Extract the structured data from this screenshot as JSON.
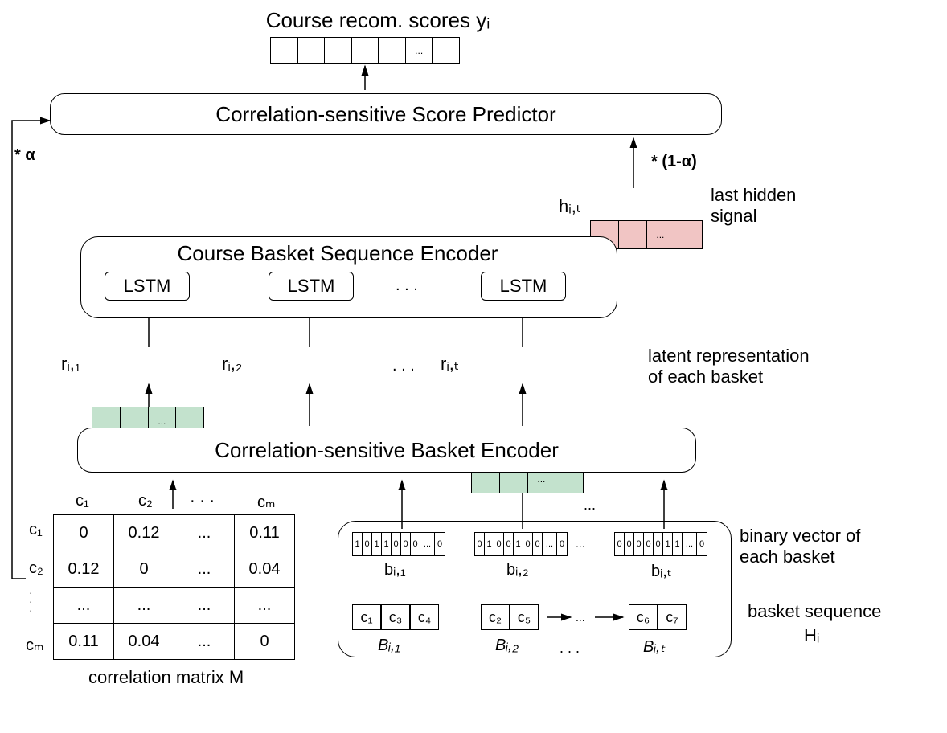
{
  "title_top": "Course recom. scores yᵢ",
  "predictor": "Correlation-sensitive Score Predictor",
  "alpha": "* α",
  "one_minus_alpha": "* (1-α)",
  "hidden_label": "hᵢ,ₜ",
  "hidden_side": "last hidden signal",
  "encoder2": "Course Basket Sequence Encoder",
  "lstm": [
    "LSTM",
    "LSTM",
    "LSTM"
  ],
  "r_labels": [
    "rᵢ,₁",
    "rᵢ,₂",
    "rᵢ,ₜ"
  ],
  "latent_side": "latent representation of each basket",
  "encoder1": "Correlation-sensitive Basket Encoder",
  "corr_headers_top": [
    "c₁",
    "c₂",
    "·  ·  ·",
    "cₘ"
  ],
  "corr_headers_left": [
    "c₁",
    "c₂",
    "cₘ"
  ],
  "corr_rows": [
    [
      "0",
      "0.12",
      "...",
      "0.11"
    ],
    [
      "0.12",
      "0",
      "...",
      "0.04"
    ],
    [
      "...",
      "...",
      "...",
      "..."
    ],
    [
      "0.11",
      "0.04",
      "...",
      "0"
    ]
  ],
  "corr_caption": "correlation matrix M",
  "bvectors": [
    [
      "1",
      "0",
      "1",
      "1",
      "0",
      "0",
      "0",
      "...",
      "0"
    ],
    [
      "0",
      "1",
      "0",
      "0",
      "1",
      "0",
      "0",
      "...",
      "0"
    ],
    [
      "0",
      "0",
      "0",
      "0",
      "0",
      "1",
      "1",
      "...",
      "0"
    ]
  ],
  "b_labels": [
    "bᵢ,₁",
    "bᵢ,₂",
    "bᵢ,ₜ"
  ],
  "binary_side": "binary vector of each basket",
  "baskets": [
    [
      "c₁",
      "c₃",
      "c₄"
    ],
    [
      "c₂",
      "c₅"
    ],
    [
      "c₆",
      "c₇"
    ]
  ],
  "B_labels": [
    "Bᵢ,₁",
    "Bᵢ,₂",
    "Bᵢ,ₜ"
  ],
  "basket_side1": "basket sequence",
  "basket_side2": "Hᵢ",
  "dots": ". . .",
  "ellipsis": "...",
  "vdots": "·\n·\n·"
}
